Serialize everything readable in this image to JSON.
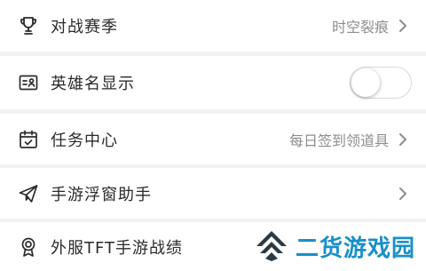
{
  "settings": {
    "items": [
      {
        "label": "对战赛季",
        "value": "时空裂痕",
        "icon": "trophy-icon"
      },
      {
        "label": "英雄名显示",
        "value": "",
        "icon": "id-card-icon",
        "toggle_on": false
      },
      {
        "label": "任务中心",
        "value": "每日签到领道具",
        "icon": "calendar-check-icon"
      },
      {
        "label": "手游浮窗助手",
        "value": "",
        "icon": "paper-plane-icon"
      },
      {
        "label": "外服TFT手游战绩",
        "value": "",
        "icon": "medal-icon"
      }
    ]
  },
  "watermark": {
    "text": "二货游戏园"
  },
  "colors": {
    "background": "#f2f2f2",
    "row": "#ffffff",
    "label": "#2b2b2b",
    "value": "#8d8d8d",
    "watermark": "#1a8fc9"
  }
}
